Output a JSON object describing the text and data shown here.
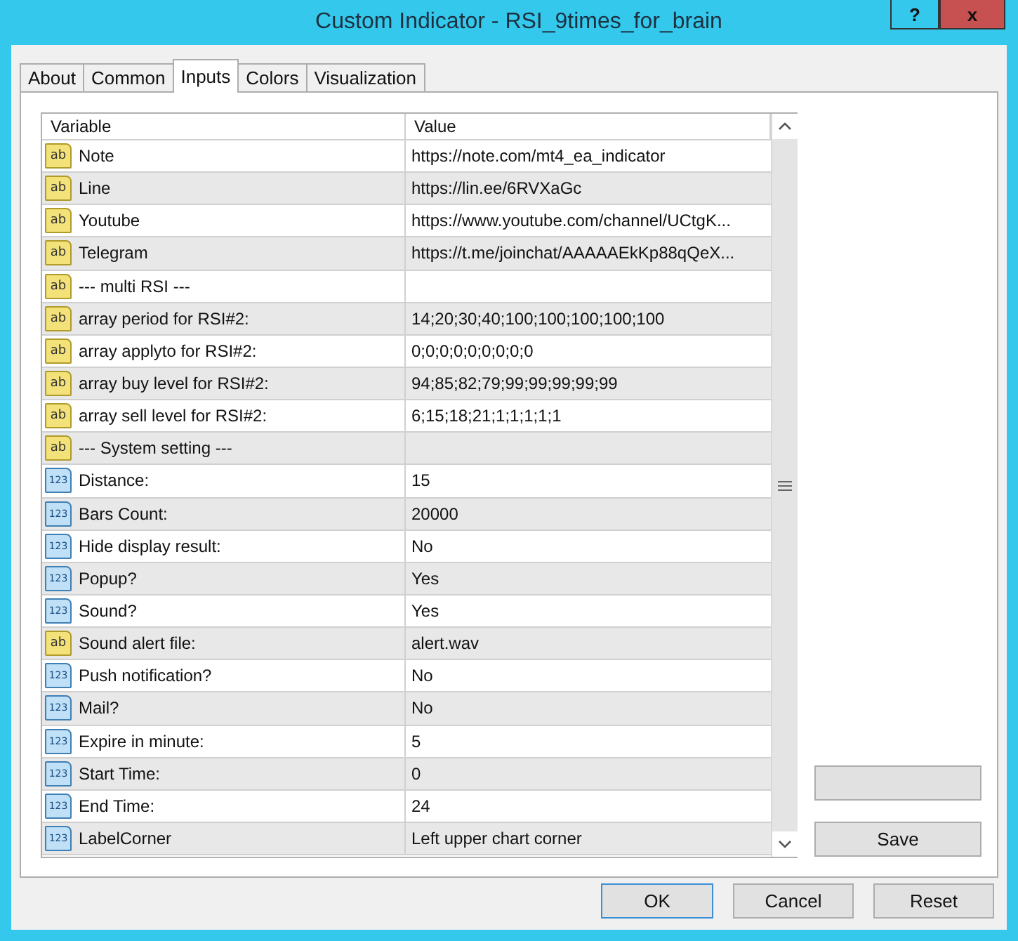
{
  "window": {
    "title": "Custom Indicator - RSI_9times_for_brain",
    "buttons": [
      {
        "kind": "help",
        "label": "?"
      },
      {
        "kind": "close",
        "label": "x"
      }
    ]
  },
  "tabs": [
    {
      "label": "About",
      "selected": false
    },
    {
      "label": "Common",
      "selected": false
    },
    {
      "label": "Inputs",
      "selected": true
    },
    {
      "label": "Colors",
      "selected": false
    },
    {
      "label": "Visualization",
      "selected": false
    }
  ],
  "table": {
    "columns": [
      "Variable",
      "Value"
    ],
    "rows": [
      {
        "kind": "string",
        "type_label": "ab",
        "variable": "Note",
        "value": "https://note.com/mt4_ea_indicator"
      },
      {
        "kind": "string",
        "type_label": "ab",
        "variable": "Line",
        "value": "https://lin.ee/6RVXaGc"
      },
      {
        "kind": "string",
        "type_label": "ab",
        "variable": "Youtube",
        "value": "https://www.youtube.com/channel/UCtgK..."
      },
      {
        "kind": "string",
        "type_label": "ab",
        "variable": "Telegram",
        "value": "https://t.me/joinchat/AAAAAEkKp88qQeX..."
      },
      {
        "kind": "string",
        "type_label": "ab",
        "variable": "--- multi RSI ---"
      },
      {
        "kind": "string",
        "type_label": "ab",
        "variable": "array period for RSI#2:",
        "value": "14;20;30;40;100;100;100;100;100"
      },
      {
        "kind": "string",
        "type_label": "ab",
        "variable": "array applyto for RSI#2:",
        "value": "0;0;0;0;0;0;0;0;0"
      },
      {
        "kind": "string",
        "type_label": "ab",
        "variable": "array buy level for RSI#2:",
        "value": "94;85;82;79;99;99;99;99;99"
      },
      {
        "kind": "string",
        "type_label": "ab",
        "variable": "array sell level for RSI#2:",
        "value": "6;15;18;21;1;1;1;1;1"
      },
      {
        "kind": "string",
        "type_label": "ab",
        "variable": "--- System setting ---"
      },
      {
        "kind": "number",
        "type_label": "123",
        "variable": "Distance:",
        "value": "15"
      },
      {
        "kind": "number",
        "type_label": "123",
        "variable": "Bars Count:",
        "value": "20000"
      },
      {
        "kind": "number",
        "type_label": "123",
        "variable": "Hide display result:",
        "value": "No"
      },
      {
        "kind": "number",
        "type_label": "123",
        "variable": "Popup?",
        "value": "Yes"
      },
      {
        "kind": "number",
        "type_label": "123",
        "variable": "Sound?",
        "value": "Yes"
      },
      {
        "kind": "string",
        "type_label": "ab",
        "variable": "Sound alert file:",
        "value": "alert.wav"
      },
      {
        "kind": "number",
        "type_label": "123",
        "variable": "Push notification?",
        "value": "No"
      },
      {
        "kind": "number",
        "type_label": "123",
        "variable": "Mail?",
        "value": "No"
      },
      {
        "kind": "number",
        "type_label": "123",
        "variable": "Expire in minute:",
        "value": "5"
      },
      {
        "kind": "number",
        "type_label": "123",
        "variable": "Start Time:",
        "value": "0"
      },
      {
        "kind": "number",
        "type_label": "123",
        "variable": "End Time:",
        "value": "24"
      },
      {
        "kind": "number",
        "type_label": "123",
        "variable": "LabelCorner",
        "value": "Left upper chart corner"
      }
    ]
  },
  "side_buttons": [
    {
      "kind": "unlabeled"
    },
    {
      "kind": "labeled",
      "label": "Save"
    }
  ],
  "footer_buttons": [
    {
      "label": "OK",
      "default": true
    },
    {
      "label": "Cancel",
      "default": false
    },
    {
      "label": "Reset",
      "default": false
    }
  ]
}
